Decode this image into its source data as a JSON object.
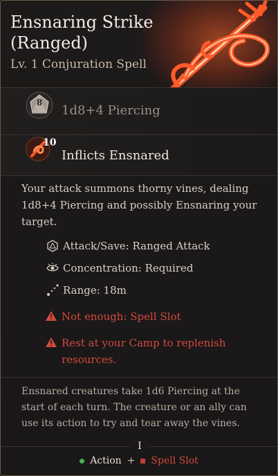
{
  "spell": {
    "title": "Ensnaring Strike (Ranged)",
    "subtitle": "Lv. 1 Conjuration Spell"
  },
  "damage": {
    "dice_value": "8",
    "text": "1d8+4 Piercing",
    "icon": "d8-die-icon"
  },
  "condition": {
    "value": "10",
    "text": "Inflicts Ensnared",
    "icon": "ensnared-icon"
  },
  "description": "Your attack summons thorny vines, dealing 1d8+4 Piercing and possibly Ensnaring your target.",
  "properties": [
    {
      "icon": "attack-save-icon",
      "text": "Attack/Save: Ranged Attack"
    },
    {
      "icon": "concentration-icon",
      "text": "Concentration: Required"
    },
    {
      "icon": "range-icon",
      "text": "Range: 18m"
    }
  ],
  "warnings": [
    {
      "icon": "warning-icon",
      "text": "Not enough: Spell Slot"
    },
    {
      "icon": "warning-icon",
      "text": "Rest at your Camp to replenish resources."
    }
  ],
  "extra_description": "Ensnared creatures take 1d6 Piercing at the start of each turn. The creature or an ally can use its action to try and tear away the vines.",
  "level_marker": "I",
  "cost": {
    "action_label": "Action",
    "plus": "+",
    "slot_label": "Spell Slot"
  },
  "colors": {
    "accent_red": "#d34a3f",
    "action_green": "#4caf50",
    "slot_red": "#c83b3b",
    "border": "#6b5a47"
  }
}
